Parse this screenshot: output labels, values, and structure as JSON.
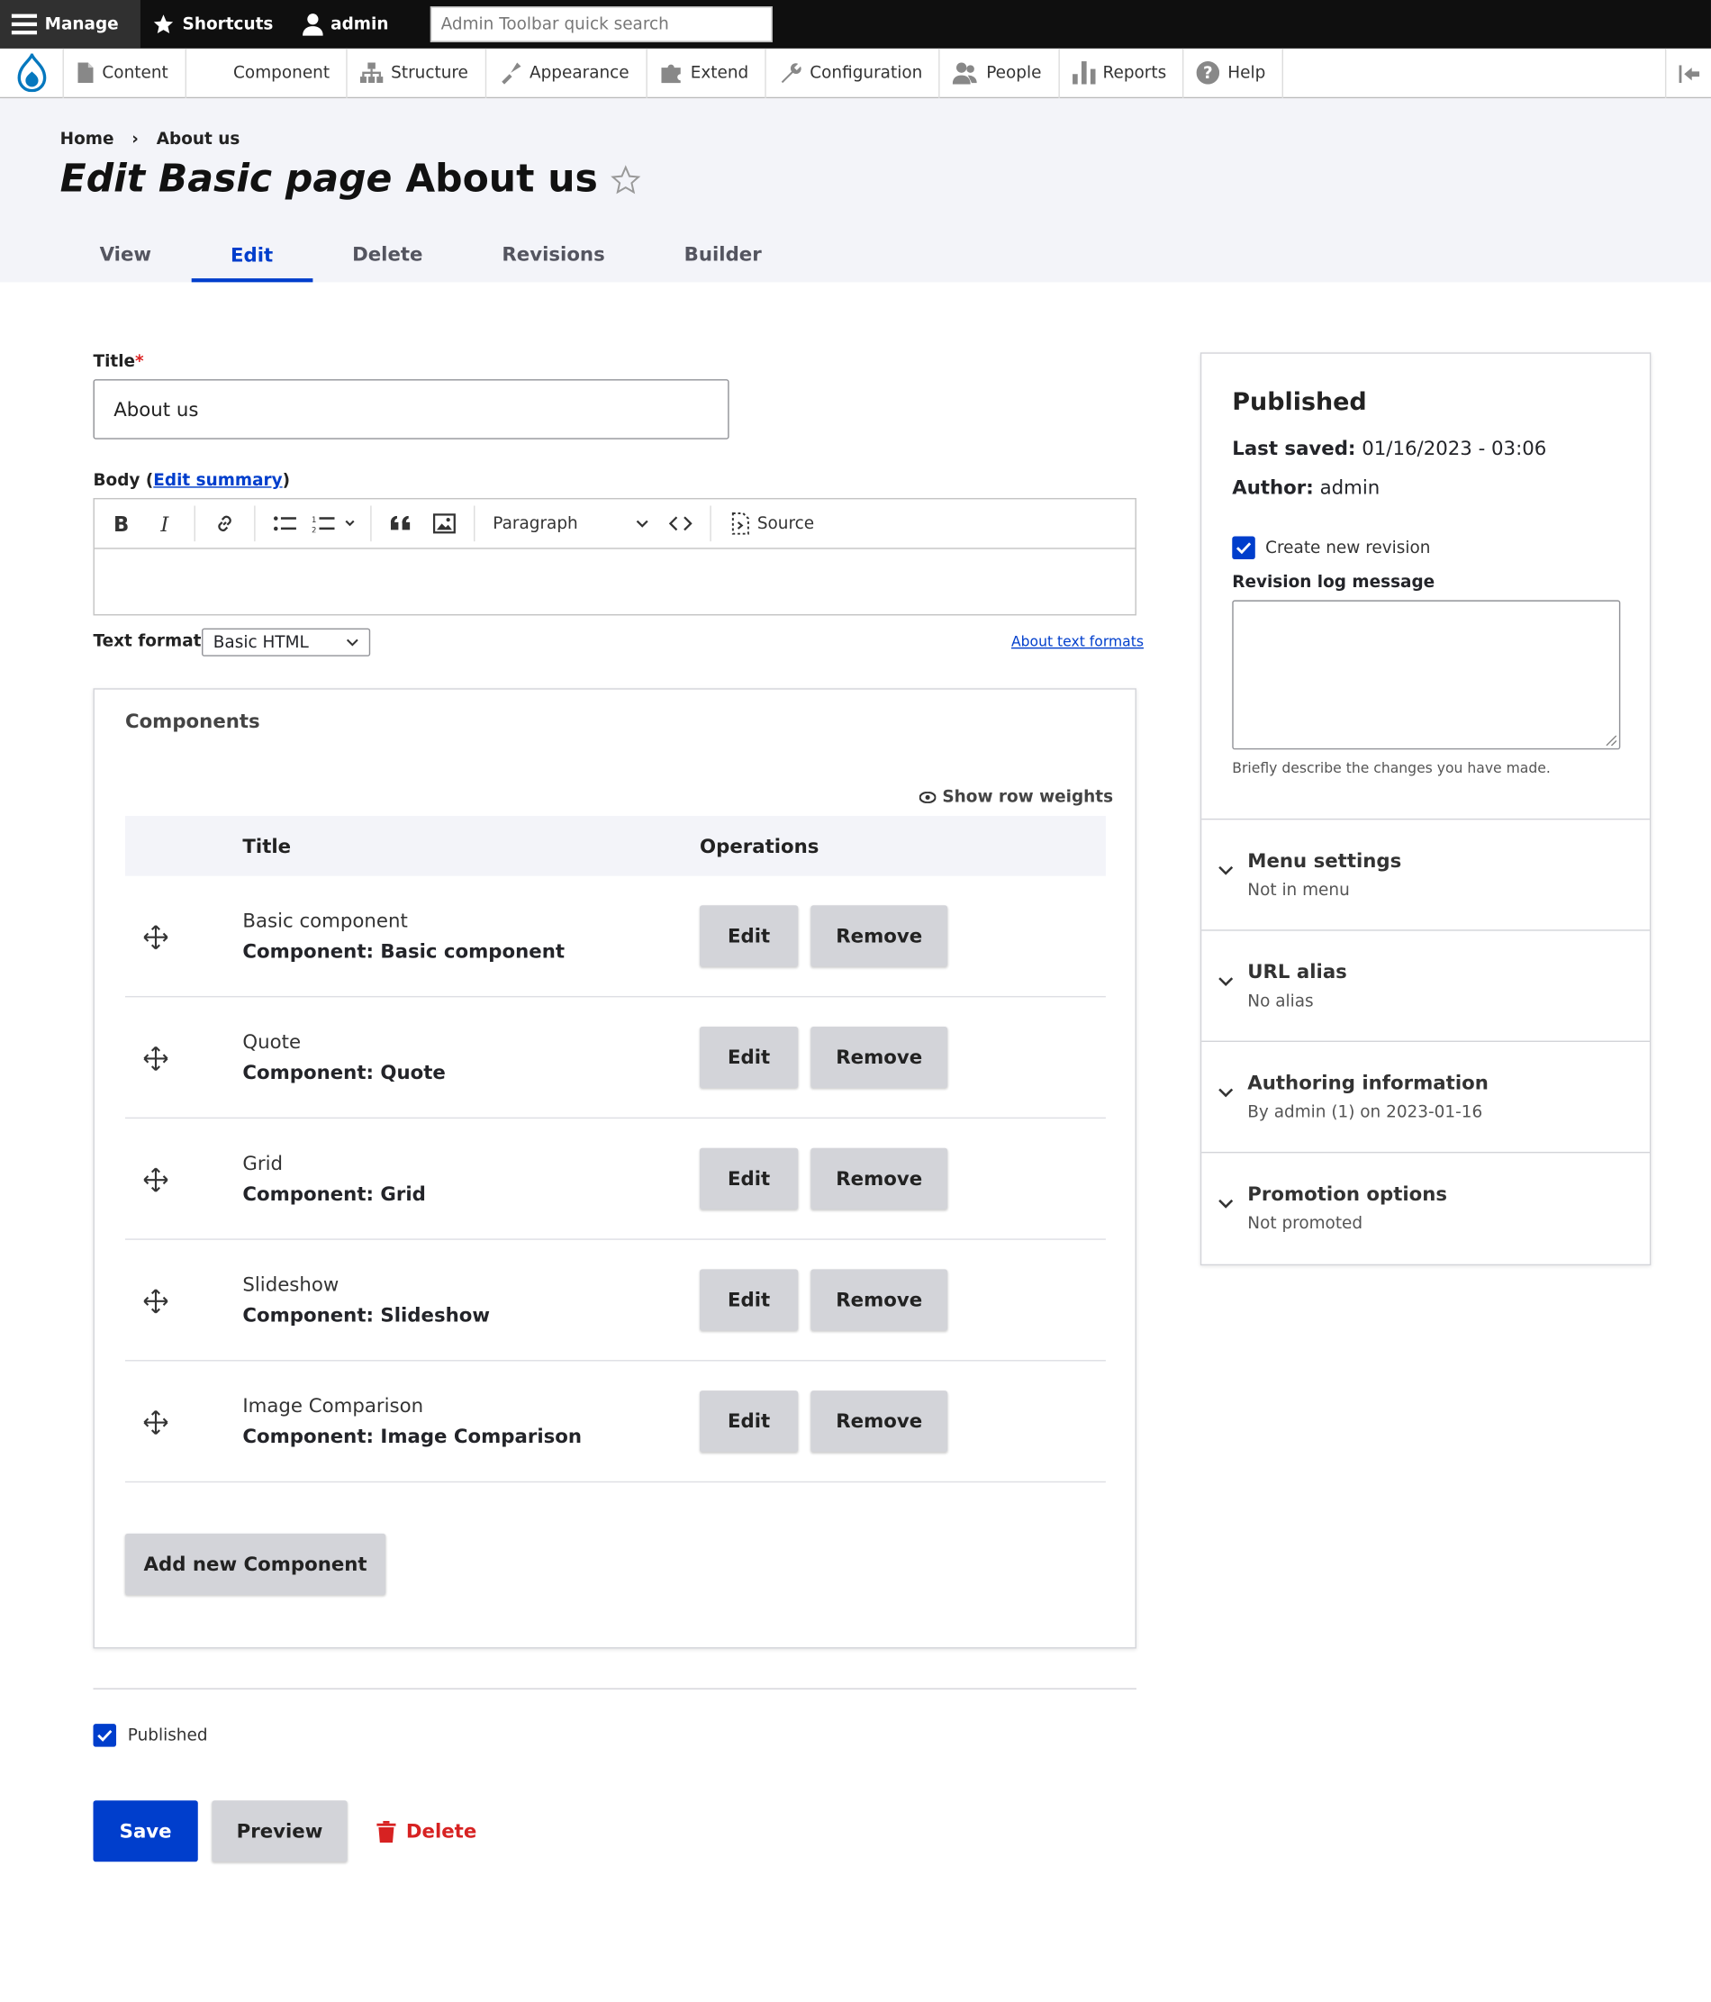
{
  "toolbar": {
    "manage": "Manage",
    "shortcuts": "Shortcuts",
    "user": "admin",
    "search_placeholder": "Admin Toolbar quick search"
  },
  "tray": {
    "items": [
      {
        "label": "Content",
        "icon": "file-icon"
      },
      {
        "label": "Component",
        "icon": ""
      },
      {
        "label": "Structure",
        "icon": "sitemap-icon"
      },
      {
        "label": "Appearance",
        "icon": "brush-icon"
      },
      {
        "label": "Extend",
        "icon": "puzzle-icon"
      },
      {
        "label": "Configuration",
        "icon": "wrench-icon"
      },
      {
        "label": "People",
        "icon": "people-icon"
      },
      {
        "label": "Reports",
        "icon": "bar-chart-icon"
      },
      {
        "label": "Help",
        "icon": "help-icon"
      }
    ]
  },
  "breadcrumb": {
    "home": "Home",
    "sep": "›",
    "current": "About us"
  },
  "page": {
    "title_italic": "Edit Basic page",
    "title_rest": "About us"
  },
  "tabs": [
    "View",
    "Edit",
    "Delete",
    "Revisions",
    "Builder"
  ],
  "form": {
    "title_label": "Title",
    "title_value": "About us",
    "body_label": "Body",
    "edit_summary": "Edit summary",
    "text_format_label": "Text format",
    "text_format_value": "Basic HTML",
    "about_text_formats": "About text formats"
  },
  "editor": {
    "paragraph": "Paragraph",
    "source": "Source"
  },
  "components": {
    "heading": "Components",
    "show_row_weights": "Show row weights",
    "col_title": "Title",
    "col_operations": "Operations",
    "edit": "Edit",
    "remove": "Remove",
    "add_new": "Add new Component",
    "rows": [
      {
        "title": "Basic component",
        "type": "Component: Basic component"
      },
      {
        "title": "Quote",
        "type": "Component: Quote"
      },
      {
        "title": "Grid",
        "type": "Component: Grid"
      },
      {
        "title": "Slideshow",
        "type": "Component: Slideshow"
      },
      {
        "title": "Image Comparison",
        "type": "Component: Image Comparison"
      }
    ]
  },
  "footer": {
    "published": "Published",
    "save": "Save",
    "preview": "Preview",
    "delete": "Delete"
  },
  "sidebar": {
    "status": "Published",
    "last_saved_label": "Last saved:",
    "last_saved_value": "01/16/2023 - 03:06",
    "author_label": "Author:",
    "author_value": "admin",
    "create_revision": "Create new revision",
    "revision_log_label": "Revision log message",
    "revision_help": "Briefly describe the changes you have made.",
    "sections": [
      {
        "title": "Menu settings",
        "summary": "Not in menu"
      },
      {
        "title": "URL alias",
        "summary": "No alias"
      },
      {
        "title": "Authoring information",
        "summary": "By admin (1) on 2023-01-16"
      },
      {
        "title": "Promotion options",
        "summary": "Not promoted"
      }
    ]
  },
  "colors": {
    "accent": "#003ecc",
    "danger": "#d72222",
    "header_bg": "#f3f4f9",
    "toolbar_bg": "#0f0f0f"
  }
}
